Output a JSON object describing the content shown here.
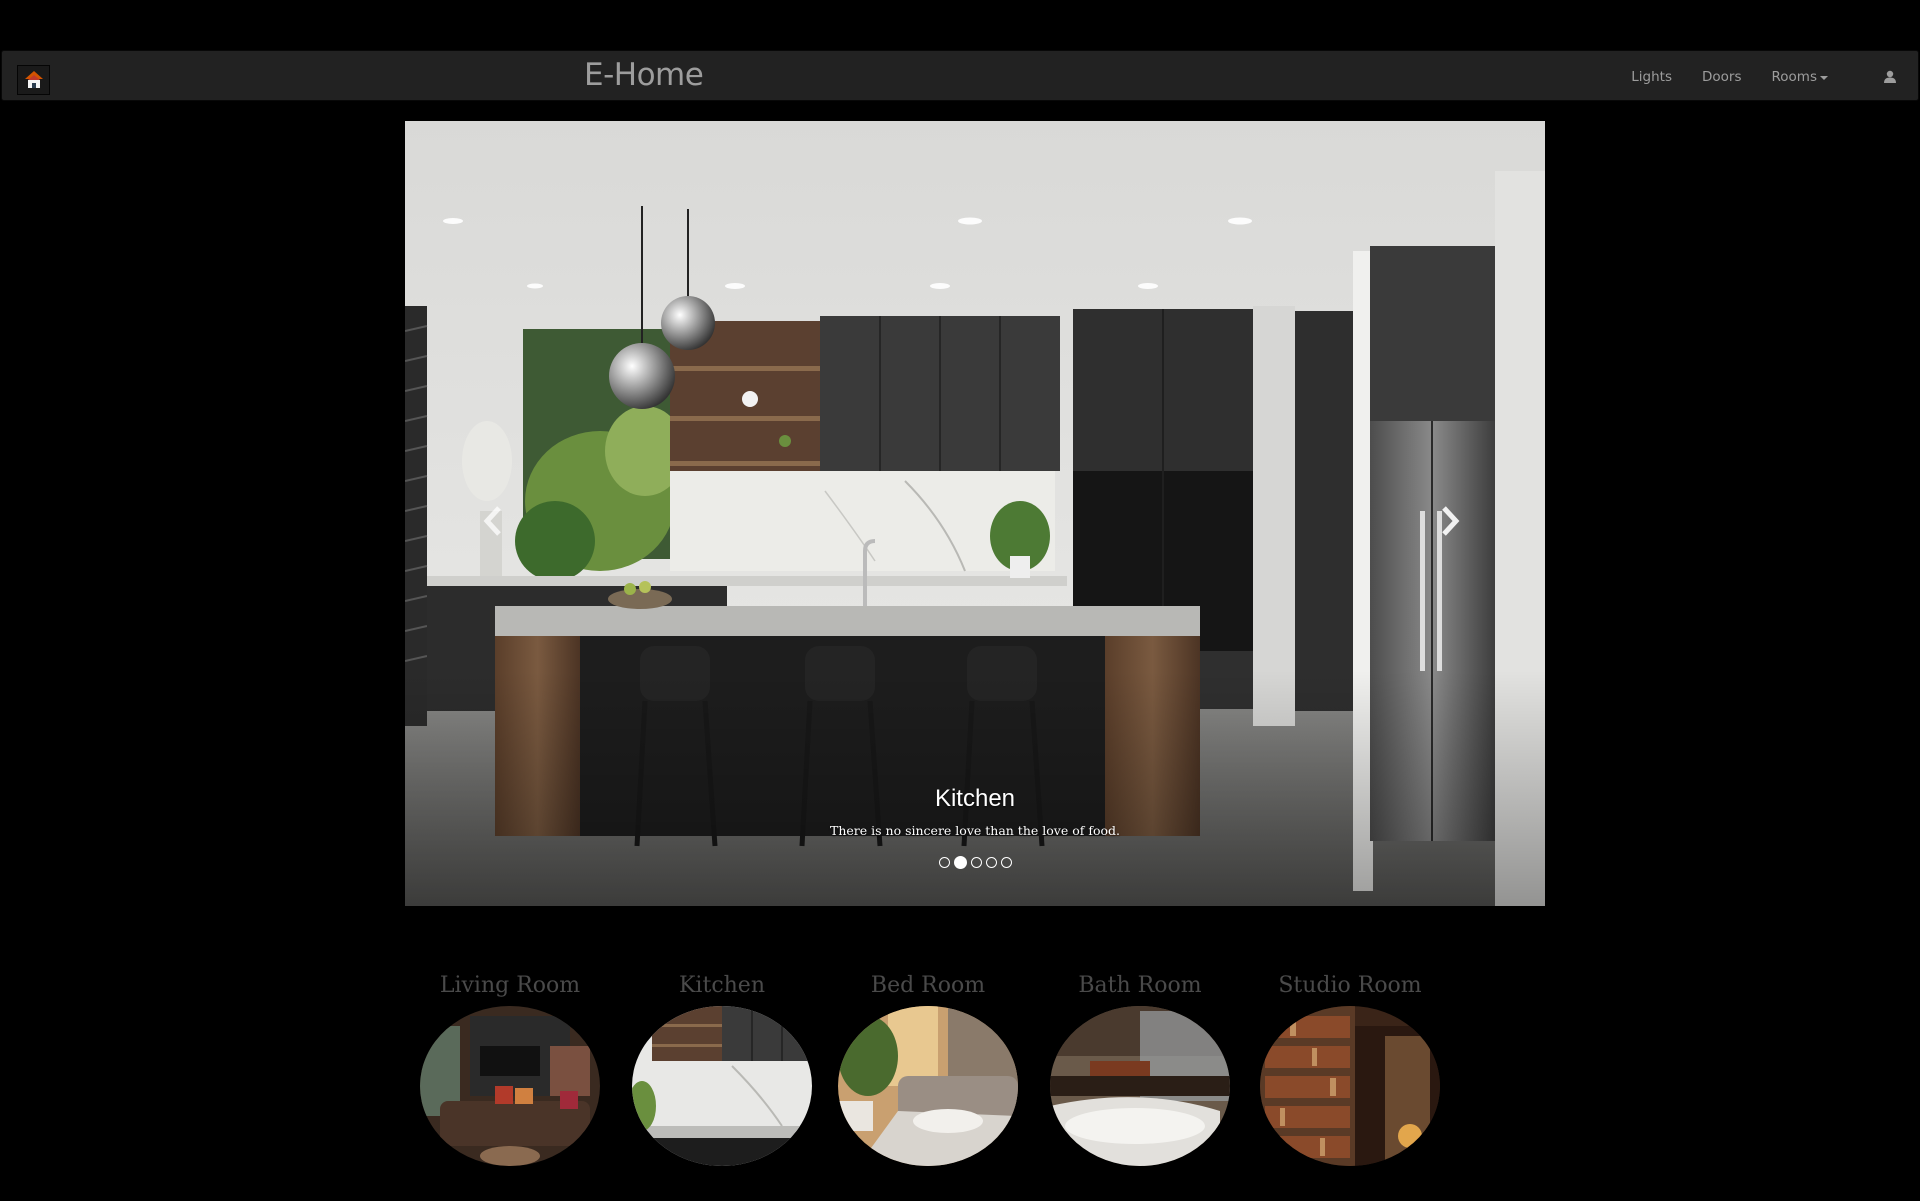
{
  "app": {
    "title": "E-Home",
    "logo_icon": "home-logo-icon"
  },
  "nav": {
    "items": [
      {
        "label": "Lights"
      },
      {
        "label": "Doors"
      },
      {
        "label": "Rooms"
      }
    ],
    "user_icon": "user-icon"
  },
  "carousel": {
    "caption_title": "Kitchen",
    "caption_text": "There is no sincere love than the love of food.",
    "slide_count": 5,
    "active_index": 1,
    "prev_icon": "chevron-left-icon",
    "next_icon": "chevron-right-icon"
  },
  "rooms": [
    {
      "label": "Living Room"
    },
    {
      "label": "Kitchen"
    },
    {
      "label": "Bed Room"
    },
    {
      "label": "Bath Room"
    },
    {
      "label": "Studio Room"
    }
  ],
  "colors": {
    "navbar_bg": "#222222",
    "nav_text": "#9d9d9d",
    "room_label": "#4a4a4a",
    "page_bg": "#000000"
  }
}
